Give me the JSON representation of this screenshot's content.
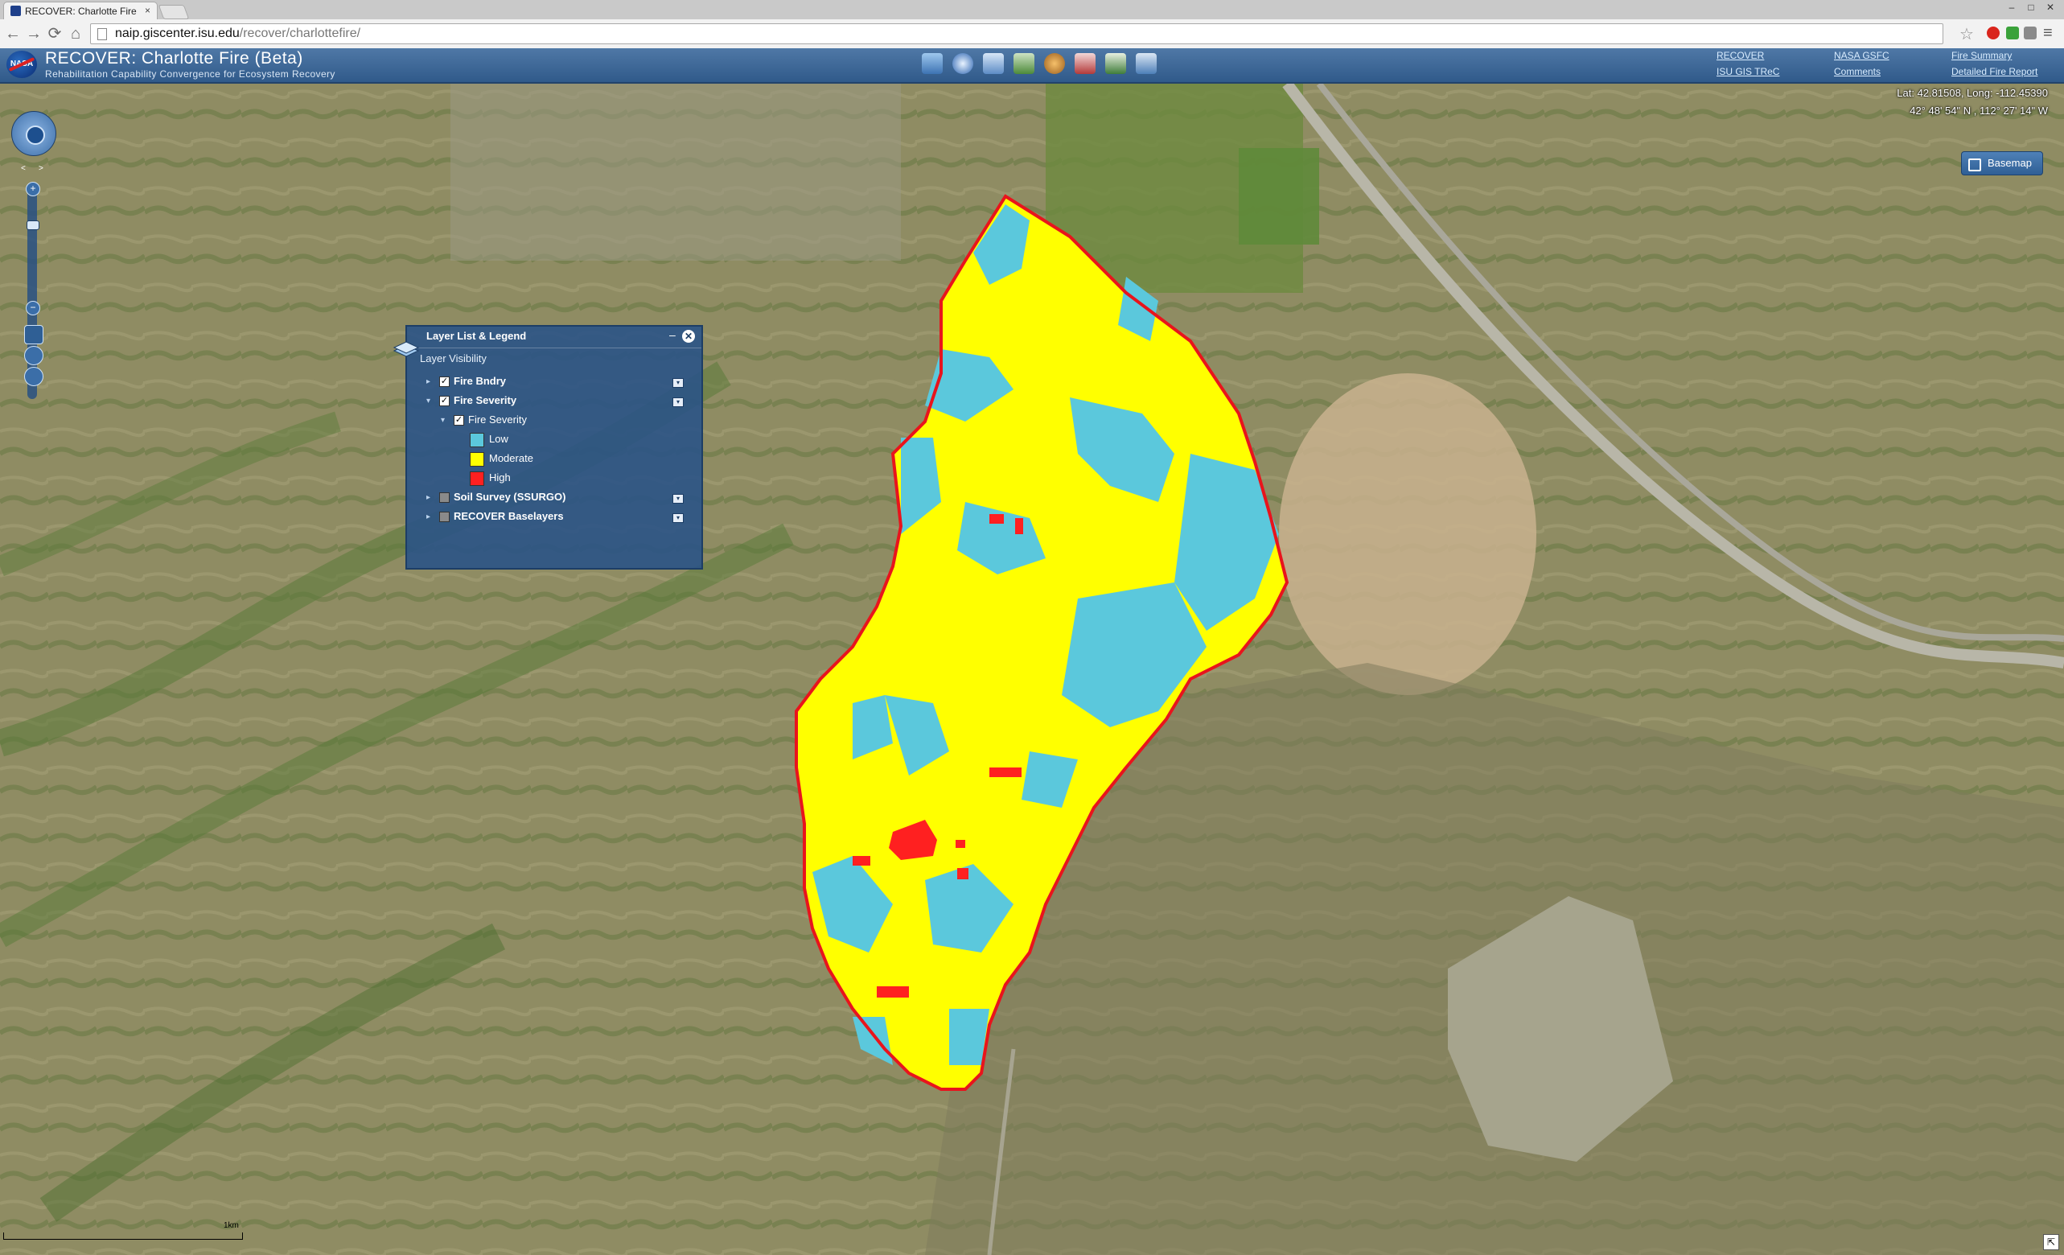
{
  "browser": {
    "tab_title": "RECOVER: Charlotte Fire (",
    "tab_close": "×",
    "url_host": "naip.giscenter.isu.edu",
    "url_path": "/recover/charlottefire/",
    "nav": {
      "back": "←",
      "forward": "→",
      "reload": "⟳",
      "home": "⌂"
    },
    "star": "☆",
    "menu": "≡",
    "window_controls": [
      "‒",
      "□",
      "✕"
    ]
  },
  "app": {
    "logo": "NASA",
    "title": "RECOVER: Charlotte Fire (Beta)",
    "subtitle": "Rehabilitation Capability Convergence for Ecosystem Recovery",
    "tools": [
      "layers-icon",
      "info-icon",
      "measure-icon",
      "draw-icon",
      "globe-icon",
      "bookmark-icon",
      "print-icon",
      "tools-icon"
    ],
    "links": {
      "recover": "RECOVER",
      "isu": "ISU GIS TReC",
      "nasa": "NASA GSFC",
      "comments": "Comments",
      "fire_summary": "Fire Summary",
      "detailed_report": "Detailed Fire Report"
    }
  },
  "map": {
    "coords_decimal": "Lat: 42.81508, Long: -112.45390",
    "coords_dms": "42° 48' 54\" N , 112° 27' 14\" W",
    "basemap_label": "Basemap",
    "scale_label": "1km",
    "nav": {
      "pan_left": "<",
      "pan_right": ">",
      "zoom_in": "+",
      "zoom_out": "−"
    }
  },
  "layer_panel": {
    "title": "Layer List & Legend",
    "minimize": "–",
    "close": "✕",
    "visibility_label": "Layer Visibility",
    "layers": [
      {
        "name": "Fire Bndry",
        "checked": true
      },
      {
        "name": "Fire Severity",
        "checked": true
      },
      {
        "name": "Soil Survey (SSURGO)",
        "checked": false
      },
      {
        "name": "RECOVER Baselayers",
        "checked": false
      }
    ],
    "sublayer": "Fire Severity",
    "legend": [
      {
        "label": "Low",
        "color": "#5bc8dc"
      },
      {
        "label": "Moderate",
        "color": "#ffff00"
      },
      {
        "label": "High",
        "color": "#ff2020"
      }
    ],
    "check_mark": "✓",
    "dropdown_glyph": "▾",
    "collapse_glyph": "▸",
    "expand_glyph": "▾"
  },
  "colors": {
    "header_blue": "#305a8a",
    "fire_boundary": "#e8141c",
    "severity_low": "#5bc8dc",
    "severity_moderate": "#ffff00",
    "severity_high": "#ff2020"
  }
}
